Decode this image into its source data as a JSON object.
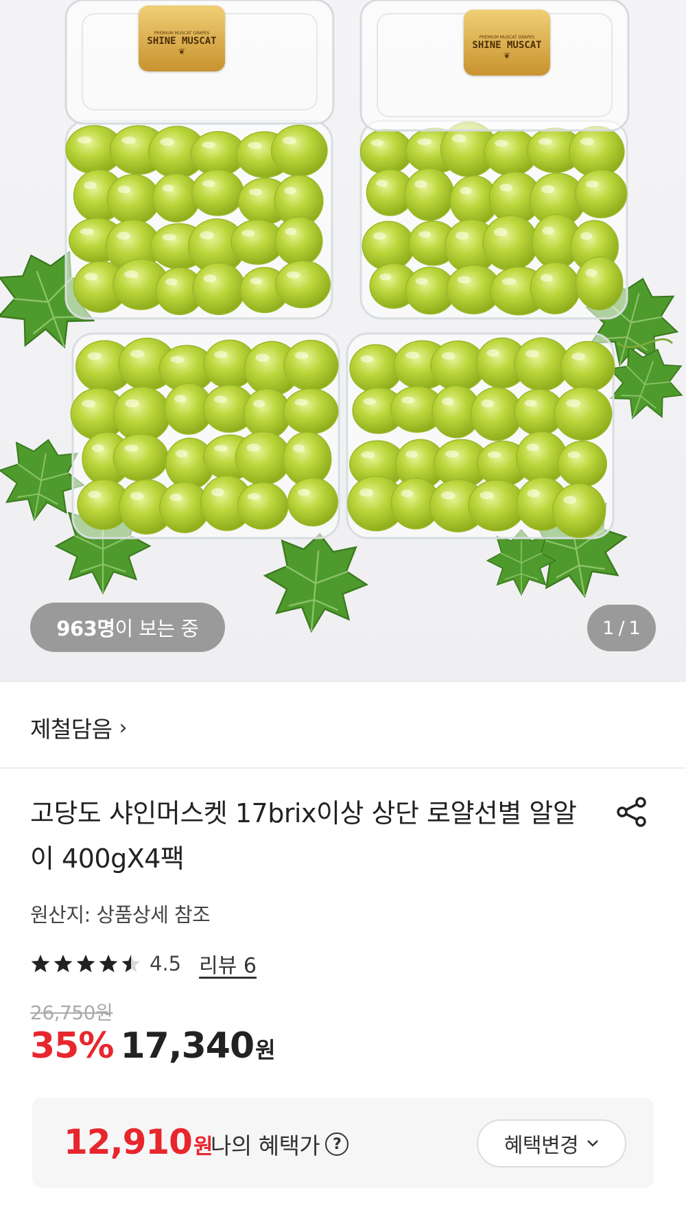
{
  "hero": {
    "badge_text": "SHINE MUSCAT",
    "badge_subtext": "PREMIUM MUSCAT GRAPES",
    "viewers_count": "963명",
    "viewers_suffix": "이 보는 중",
    "counter_current": "1",
    "counter_sep": "/",
    "counter_total": "1"
  },
  "seller": {
    "name": "제철담음",
    "chevron": "›"
  },
  "product": {
    "title": "고당도 샤인머스켓 17brix이상 상단 로얄선별 알알이 400gX4팩",
    "origin": "원산지: 상품상세 참조"
  },
  "rating": {
    "score": "4.5",
    "score_value": 4.5,
    "max": 5,
    "review_label": "리뷰 6"
  },
  "price": {
    "original": "26,750원",
    "discount": "35%",
    "sale": "17,340",
    "currency": "원"
  },
  "benefit": {
    "price": "12,910",
    "currency": "원",
    "label": "나의 혜택가",
    "help_symbol": "?",
    "change_button": "혜택변경",
    "chevron": "⌄"
  },
  "colors": {
    "accent_red": "#e8262d",
    "text": "#222222",
    "grape_green": "#b5d233"
  }
}
